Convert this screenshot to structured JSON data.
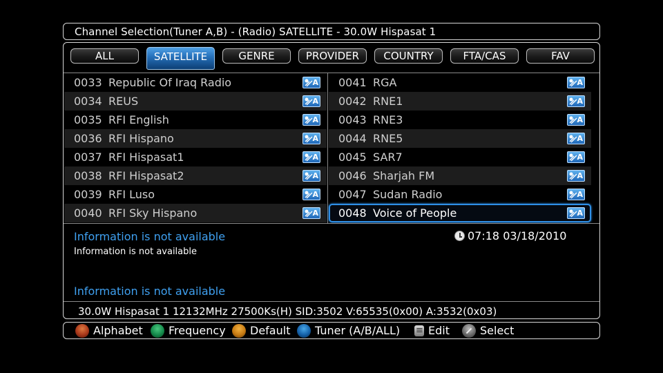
{
  "title": "Channel Selection(Tuner A,B) - (Radio) SATELLITE -  30.0W Hispasat 1",
  "tabs": [
    {
      "label": "ALL",
      "active": false
    },
    {
      "label": "SATELLITE",
      "active": true
    },
    {
      "label": "GENRE",
      "active": false
    },
    {
      "label": "PROVIDER",
      "active": false
    },
    {
      "label": "COUNTRY",
      "active": false
    },
    {
      "label": "FTA/CAS",
      "active": false
    },
    {
      "label": "FAV",
      "active": false
    }
  ],
  "channels_left": [
    {
      "num": "0033",
      "name": "Republic Of Iraq Radio"
    },
    {
      "num": "0034",
      "name": "REUS"
    },
    {
      "num": "0035",
      "name": "RFI English"
    },
    {
      "num": "0036",
      "name": "RFI Hispano"
    },
    {
      "num": "0037",
      "name": "RFI Hispasat1"
    },
    {
      "num": "0038",
      "name": "RFI Hispasat2"
    },
    {
      "num": "0039",
      "name": "RFI Luso"
    },
    {
      "num": "0040",
      "name": "RFI Sky Hispano"
    }
  ],
  "channels_right": [
    {
      "num": "0041",
      "name": "RGA"
    },
    {
      "num": "0042",
      "name": "RNE1"
    },
    {
      "num": "0043",
      "name": "RNE3"
    },
    {
      "num": "0044",
      "name": "RNE5"
    },
    {
      "num": "0045",
      "name": "SAR7"
    },
    {
      "num": "0046",
      "name": "Sharjah FM"
    },
    {
      "num": "0047",
      "name": "Sudan Radio"
    },
    {
      "num": "0048",
      "name": "Voice of People"
    }
  ],
  "selected_channel": "0048",
  "channel_icon": {
    "name": "satellite-tuner-a-icon",
    "letter": "A",
    "color": "#2d86d4"
  },
  "info": {
    "title": "Information is not available",
    "subtitle": "Information is not available",
    "bottom": "Information is not available"
  },
  "datetime": "07:18 03/18/2010",
  "transponder": "30.0W Hispasat 1 12132MHz 27500Ks(H) SID:3502 V:65535(0x00) A:3532(0x03)",
  "footer": {
    "red": "Alphabet",
    "green": "Frequency",
    "yellow": "Default",
    "blue": "Tuner (A/B/ALL)",
    "edit": "Edit",
    "select": "Select"
  },
  "colors": {
    "accent": "#2e8fe6",
    "info_text": "#3fa0f0"
  }
}
